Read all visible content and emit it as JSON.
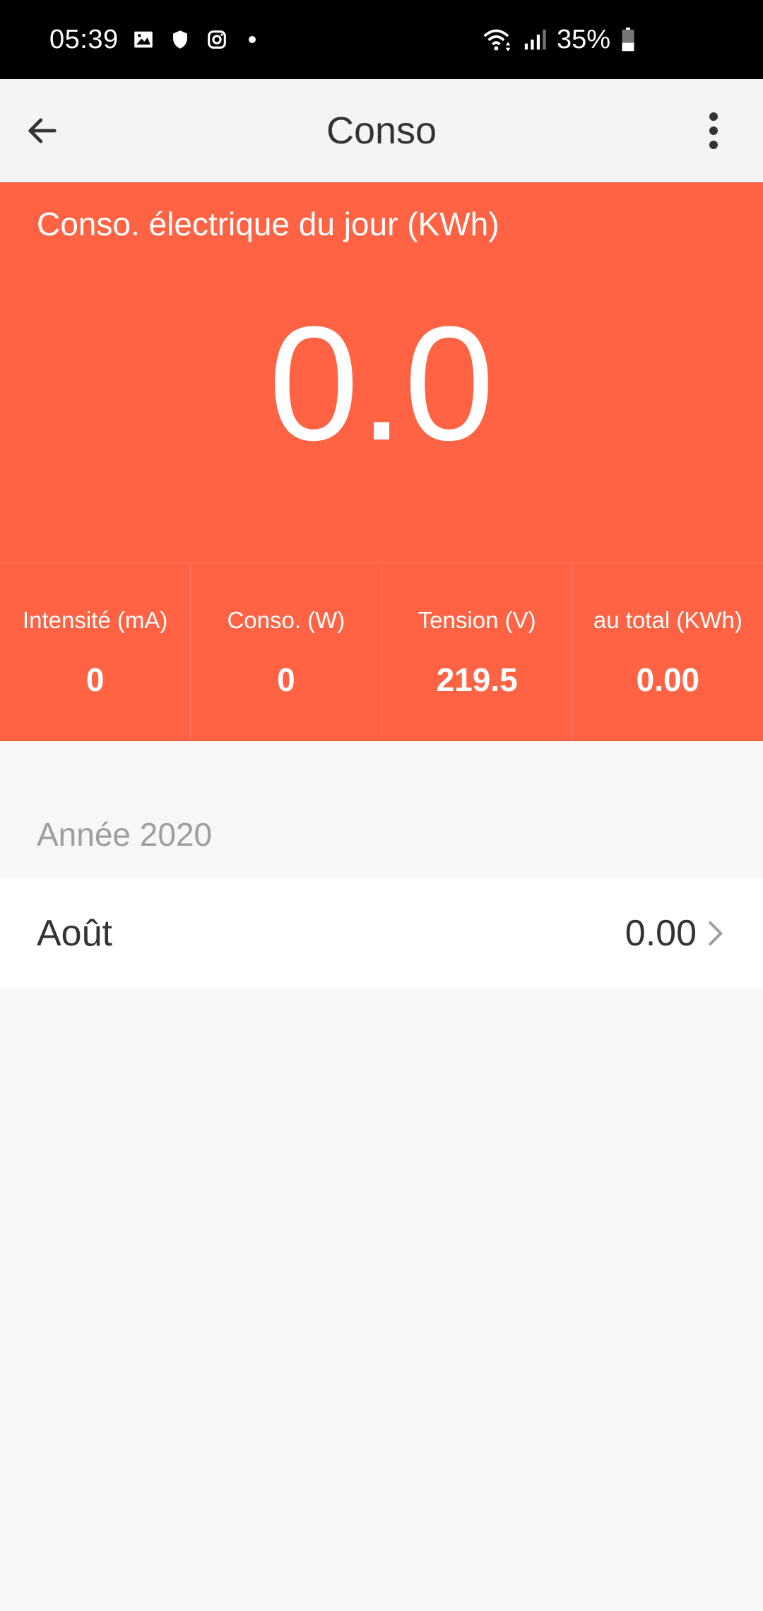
{
  "status_bar": {
    "time": "05:39",
    "battery": "35%",
    "icons": [
      "gallery-icon",
      "shield-icon",
      "instagram-icon",
      "dot-icon",
      "wifi-icon",
      "signal-icon",
      "battery-icon"
    ]
  },
  "app_bar": {
    "title": "Conso"
  },
  "hero": {
    "label": "Conso. électrique du jour (KWh)",
    "value": "0.0"
  },
  "metrics": [
    {
      "label": "Intensité (mA)",
      "value": "0"
    },
    {
      "label": "Conso. (W)",
      "value": "0"
    },
    {
      "label": "Tension (V)",
      "value": "219.5"
    },
    {
      "label": "au total (KWh)",
      "value": "0.00"
    }
  ],
  "history": {
    "year_label": "Année 2020",
    "months": [
      {
        "name": "Août",
        "value": "0.00"
      }
    ]
  },
  "colors": {
    "accent": "#ff6343",
    "background": "#f7f7f7",
    "status_bar": "#000000"
  }
}
